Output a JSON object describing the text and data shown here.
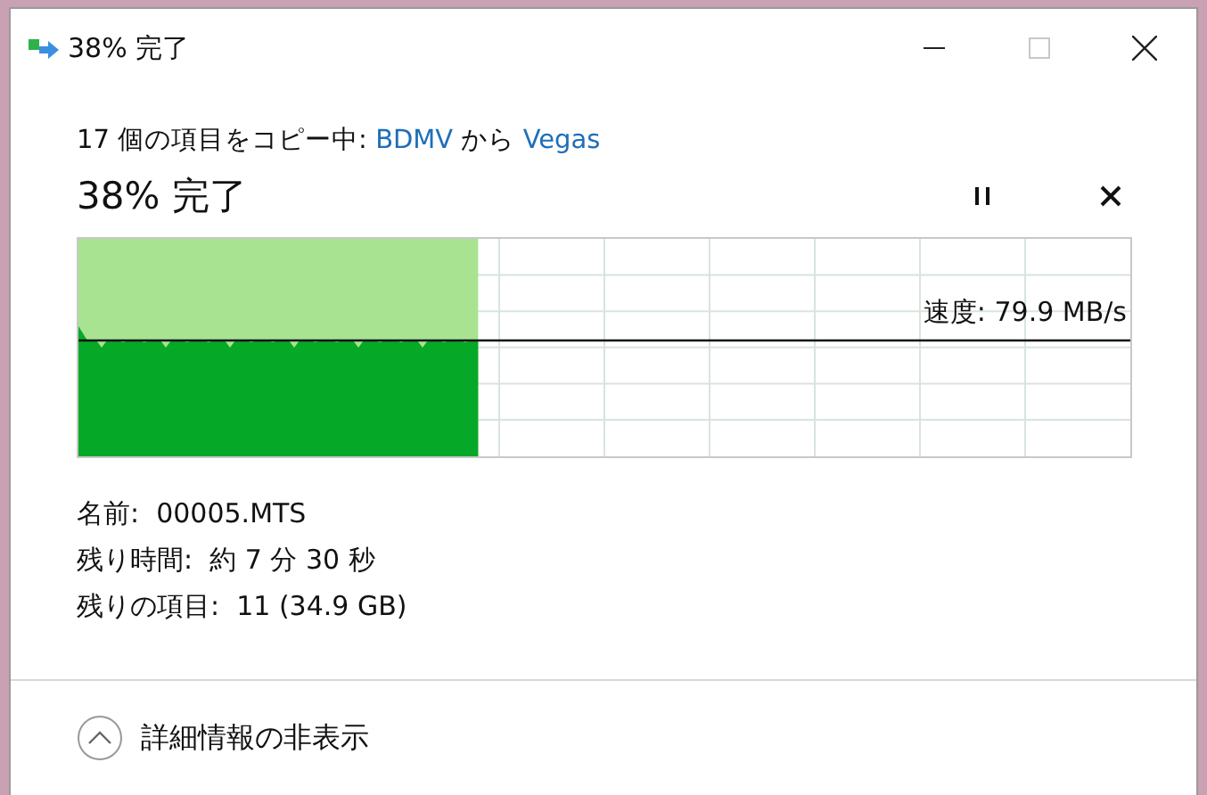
{
  "window": {
    "title": "38% 完了"
  },
  "header": {
    "parts": [
      {
        "kind": "text",
        "text": "17 個の項目をコピー中: "
      },
      {
        "kind": "link",
        "text": "BDMV"
      },
      {
        "kind": "text",
        "text": " から "
      },
      {
        "kind": "link",
        "text": "Vegas"
      }
    ]
  },
  "progress": {
    "status": "38% 完了",
    "level": 0.38,
    "speed": "速度: 79.9 MB/s"
  },
  "details": [
    "名前:  00005.MTS",
    "残り時間:  約 7 分 30 秒",
    "残りの項目:  11 (34.9 GB)"
  ],
  "footer": {
    "toggle": "詳細情報の非表示"
  }
}
